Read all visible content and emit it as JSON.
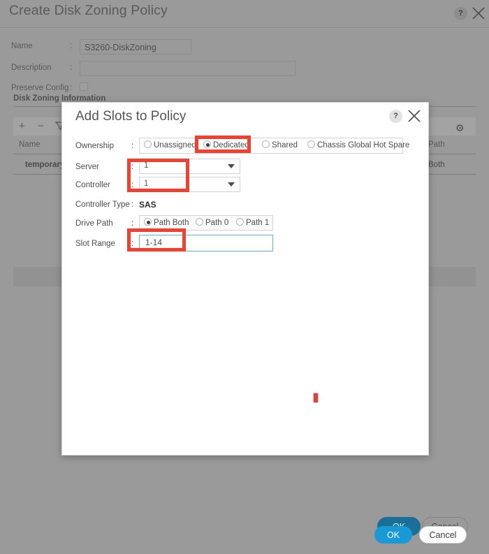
{
  "outer_window": {
    "title": "Create Disk Zoning Policy",
    "help_icon": "question-mark-icon",
    "close_icon": "close-icon",
    "form": {
      "name_label": "Name",
      "name_value": "S3260-DiskZoning",
      "description_label": "Description",
      "description_value": "",
      "preserve_config_label": "Preserve Config",
      "preserve_config_checked": false,
      "colon": ":"
    },
    "section": {
      "title": "Disk Zoning Information",
      "toolbar": {
        "add_icon": "plus-icon",
        "remove_icon": "minus-icon",
        "filter_icon": "filter-icon",
        "settings_icon": "gear-icon"
      },
      "table": {
        "columns": [
          "Name",
          "Path"
        ],
        "rows": [
          {
            "name": "temporary",
            "path": "Both"
          }
        ]
      }
    },
    "footer": {
      "ok_label": "OK",
      "cancel_label": "Cancel"
    }
  },
  "inner_dialog": {
    "title": "Add Slots to Policy",
    "help_icon": "question-mark-icon",
    "close_icon": "close-icon",
    "colon": ":",
    "fields": {
      "ownership": {
        "label": "Ownership",
        "options": [
          {
            "label": "Unassigned",
            "selected": false
          },
          {
            "label": "Dedicated",
            "selected": true
          },
          {
            "label": "Shared",
            "selected": false
          },
          {
            "label": "Chassis Global Hot Spare",
            "selected": false
          }
        ],
        "selected": "Dedicated"
      },
      "server": {
        "label": "Server",
        "value": "1",
        "dropdown_icon": "chevron-down-icon"
      },
      "controller": {
        "label": "Controller",
        "value": "1",
        "dropdown_icon": "chevron-down-icon"
      },
      "controller_type": {
        "label": "Controller Type",
        "value": "SAS"
      },
      "drive_path": {
        "label": "Drive Path",
        "options": [
          {
            "label": "Path Both",
            "selected": true
          },
          {
            "label": "Path 0",
            "selected": false
          },
          {
            "label": "Path 1",
            "selected": false
          }
        ],
        "selected": "Path Both"
      },
      "slot_range": {
        "label": "Slot Range",
        "value": "1-14",
        "placeholder": ""
      }
    },
    "footer": {
      "ok_label": "OK",
      "cancel_label": "Cancel"
    }
  },
  "annotations": {
    "highlight_color": "#f04030",
    "boxes": [
      {
        "target": "Dedicated"
      },
      {
        "target": "Server and Controller"
      },
      {
        "target": "Slot Range"
      }
    ],
    "cursor_marker_color": "#f03c2e"
  },
  "colors": {
    "overlay_dim": "#9a9a9a",
    "primary_button": "#199ad6",
    "focus_border": "#5cb4e4",
    "dialog_background": "#ffffff"
  }
}
